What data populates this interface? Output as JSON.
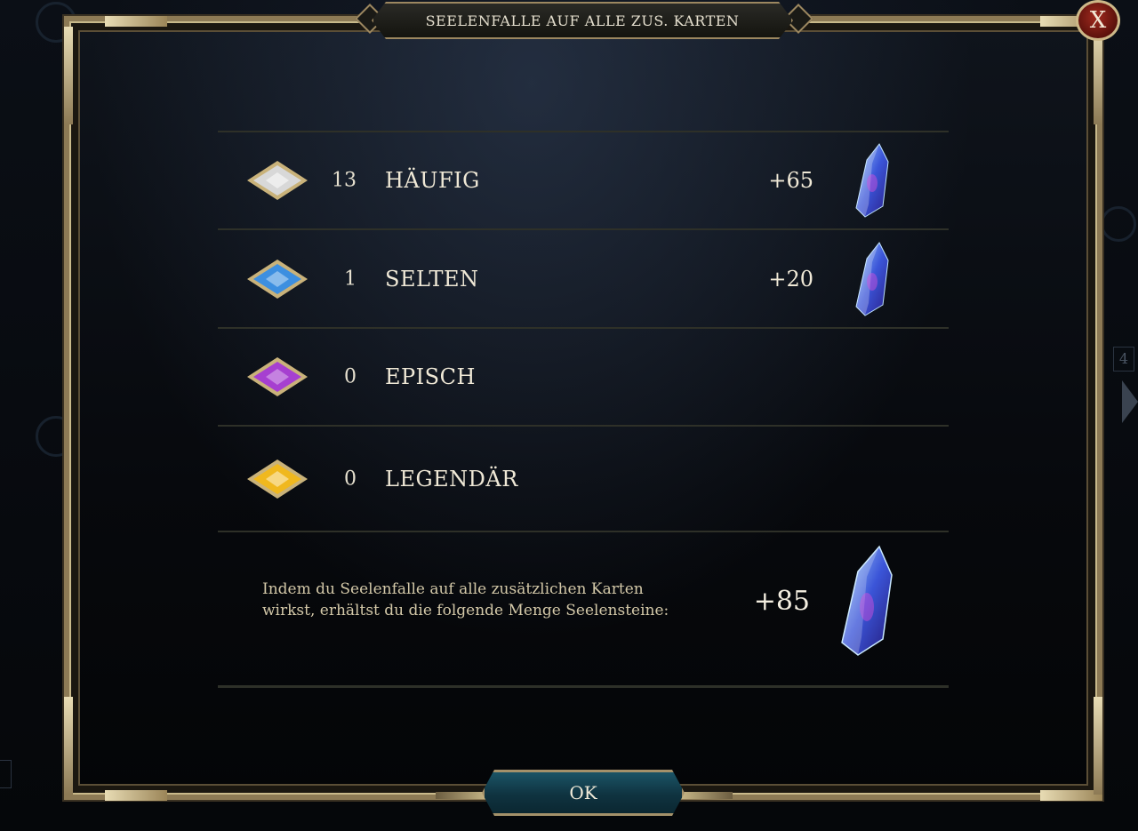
{
  "dialog": {
    "title": "SEELENFALLE AUF ALLE ZUS. KARTEN",
    "close_label": "X",
    "rows": [
      {
        "gem_color": "#d8d8d8",
        "count": "13",
        "rarity": "HÄUFIG",
        "gain": "+65",
        "show_crystal": true
      },
      {
        "gem_color": "#3d8fe0",
        "count": "1",
        "rarity": "SELTEN",
        "gain": "+20",
        "show_crystal": true
      },
      {
        "gem_color": "#a63fd0",
        "count": "0",
        "rarity": "EPISCH",
        "gain": "",
        "show_crystal": false
      },
      {
        "gem_color": "#f0b81e",
        "count": "0",
        "rarity": "LEGENDÄR",
        "gain": "",
        "show_crystal": false
      }
    ],
    "summary": {
      "description_line1": "Indem du Seelenfalle auf alle zusätzlichen Karten",
      "description_line2": "wirkst, erhältst du die folgende Menge Seelensteine:",
      "total": "+85"
    },
    "ok_label": "OK"
  },
  "background": {
    "side_number": "4"
  },
  "icons": {
    "rarity_gem": "diamond-gem-icon",
    "soulstone": "soulstone-crystal-icon",
    "close": "close-icon"
  }
}
